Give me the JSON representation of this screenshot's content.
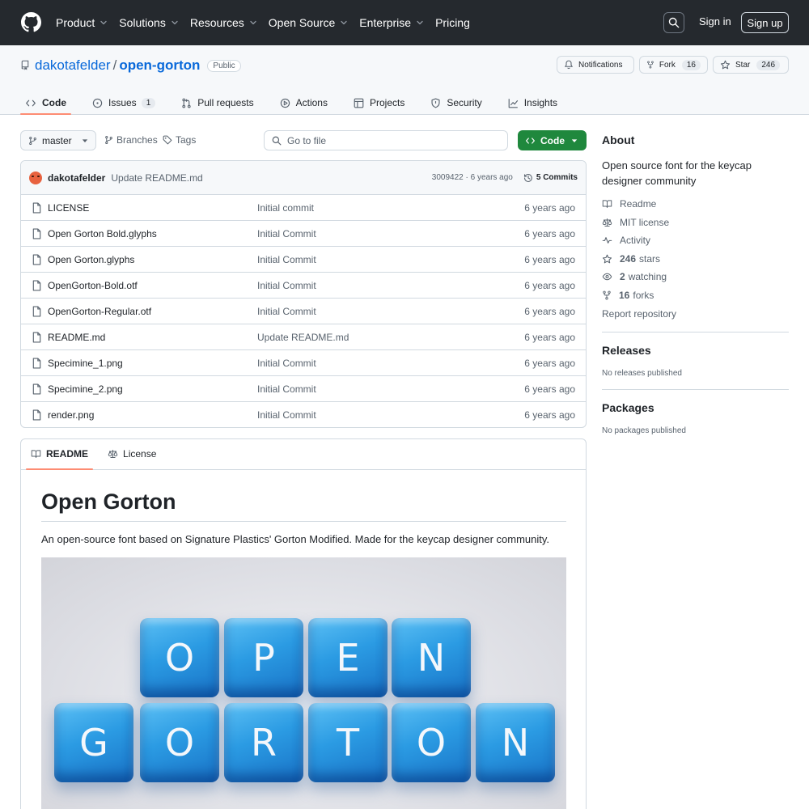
{
  "header": {
    "nav": [
      {
        "label": "Product",
        "dropdown": true
      },
      {
        "label": "Solutions",
        "dropdown": true
      },
      {
        "label": "Resources",
        "dropdown": true
      },
      {
        "label": "Open Source",
        "dropdown": true
      },
      {
        "label": "Enterprise",
        "dropdown": true
      },
      {
        "label": "Pricing",
        "dropdown": false
      }
    ],
    "signin": "Sign in",
    "signup": "Sign up"
  },
  "repo": {
    "owner": "dakotafelder",
    "separator": "/",
    "name": "open-gorton",
    "visibility": "Public",
    "notifications_label": "Notifications",
    "fork_label": "Fork",
    "fork_count": "16",
    "star_label": "Star",
    "star_count": "246"
  },
  "repo_nav": [
    {
      "label": "Code",
      "icon": "code-icon",
      "active": true,
      "count": ""
    },
    {
      "label": "Issues",
      "icon": "issue-icon",
      "active": false,
      "count": "1"
    },
    {
      "label": "Pull requests",
      "icon": "pull-request-icon",
      "active": false,
      "count": ""
    },
    {
      "label": "Actions",
      "icon": "play-icon",
      "active": false,
      "count": ""
    },
    {
      "label": "Projects",
      "icon": "table-icon",
      "active": false,
      "count": ""
    },
    {
      "label": "Security",
      "icon": "shield-icon",
      "active": false,
      "count": ""
    },
    {
      "label": "Insights",
      "icon": "graph-icon",
      "active": false,
      "count": ""
    }
  ],
  "toolbar": {
    "branch": "master",
    "branches_label": "Branches",
    "tags_label": "Tags",
    "goto_placeholder": "Go to file",
    "code_label": "Code"
  },
  "last_commit": {
    "author": "dakotafelder",
    "message": "Update README.md",
    "hash": "3009422",
    "separator": "·",
    "age": "6 years ago",
    "commits_label": "5 Commits"
  },
  "files": [
    {
      "name": "LICENSE",
      "commit": "Initial commit",
      "age": "6 years ago"
    },
    {
      "name": "Open Gorton Bold.glyphs",
      "commit": "Initial Commit",
      "age": "6 years ago"
    },
    {
      "name": "Open Gorton.glyphs",
      "commit": "Initial Commit",
      "age": "6 years ago"
    },
    {
      "name": "OpenGorton-Bold.otf",
      "commit": "Initial Commit",
      "age": "6 years ago"
    },
    {
      "name": "OpenGorton-Regular.otf",
      "commit": "Initial Commit",
      "age": "6 years ago"
    },
    {
      "name": "README.md",
      "commit": "Update README.md",
      "age": "6 years ago"
    },
    {
      "name": "Specimine_1.png",
      "commit": "Initial Commit",
      "age": "6 years ago"
    },
    {
      "name": "Specimine_2.png",
      "commit": "Initial Commit",
      "age": "6 years ago"
    },
    {
      "name": "render.png",
      "commit": "Initial Commit",
      "age": "6 years ago"
    }
  ],
  "readme": {
    "tab_readme": "README",
    "tab_license": "License",
    "title": "Open Gorton",
    "paragraph": "An open-source font based on Signature Plastics' Gorton Modified. Made for the keycap designer community.",
    "image_keys_row1": [
      "O",
      "P",
      "E",
      "N"
    ],
    "image_keys_row2": [
      "G",
      "O",
      "R",
      "T",
      "O",
      "N"
    ]
  },
  "sidebar": {
    "about_title": "About",
    "description": "Open source font for the keycap designer community",
    "items": [
      {
        "icon": "book-icon",
        "strong": "",
        "label": "Readme"
      },
      {
        "icon": "law-icon",
        "strong": "",
        "label": "MIT license"
      },
      {
        "icon": "pulse-icon",
        "strong": "",
        "label": "Activity"
      },
      {
        "icon": "star-icon",
        "strong": "246",
        "label": "stars"
      },
      {
        "icon": "eye-icon",
        "strong": "2",
        "label": "watching"
      },
      {
        "icon": "fork-icon",
        "strong": "16",
        "label": "forks"
      }
    ],
    "report": "Report repository",
    "releases_title": "Releases",
    "releases_text": "No releases published",
    "packages_title": "Packages",
    "packages_text": "No packages published"
  },
  "colors": {
    "header_bg": "#25292e",
    "link": "#0969da",
    "primary_button": "#1f883d",
    "active_tab_underline": "#fd8c73",
    "keycap_blue": "#2b9be3"
  }
}
